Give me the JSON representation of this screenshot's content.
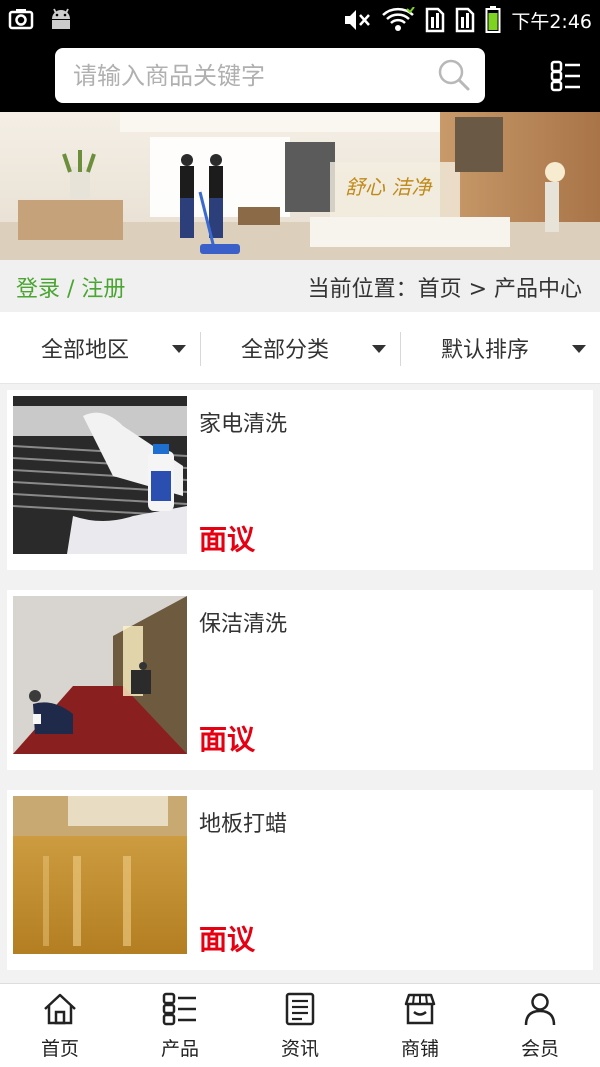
{
  "status_bar": {
    "time": "下午2:46",
    "icons": [
      "screenshot-icon",
      "android-icon",
      "mute-icon",
      "wifi-icon",
      "sim1-icon",
      "sim2-icon",
      "battery-icon"
    ]
  },
  "search": {
    "placeholder": "请输入商品关键字",
    "value": ""
  },
  "location": {
    "login_label": "登录 / 注册",
    "breadcrumb": "当前位置：首页 > 产品中心"
  },
  "filters": [
    {
      "label": "全部地区"
    },
    {
      "label": "全部分类"
    },
    {
      "label": "默认排序"
    }
  ],
  "products": [
    {
      "title": "家电清洗",
      "price": "面议",
      "image": "aircon-cleaning-photo"
    },
    {
      "title": "保洁清洗",
      "price": "面议",
      "image": "corridor-cleaning-photo"
    },
    {
      "title": "地板打蜡",
      "price": "面议",
      "image": "floor-waxing-photo"
    }
  ],
  "bottom_nav": [
    {
      "label": "首页",
      "icon": "home-icon"
    },
    {
      "label": "产品",
      "icon": "product-grid-icon"
    },
    {
      "label": "资讯",
      "icon": "news-icon"
    },
    {
      "label": "商铺",
      "icon": "shop-icon"
    },
    {
      "label": "会员",
      "icon": "member-icon"
    }
  ],
  "colors": {
    "accent_green": "#4aa532",
    "price_red": "#e60012",
    "header_bg": "#000000"
  }
}
